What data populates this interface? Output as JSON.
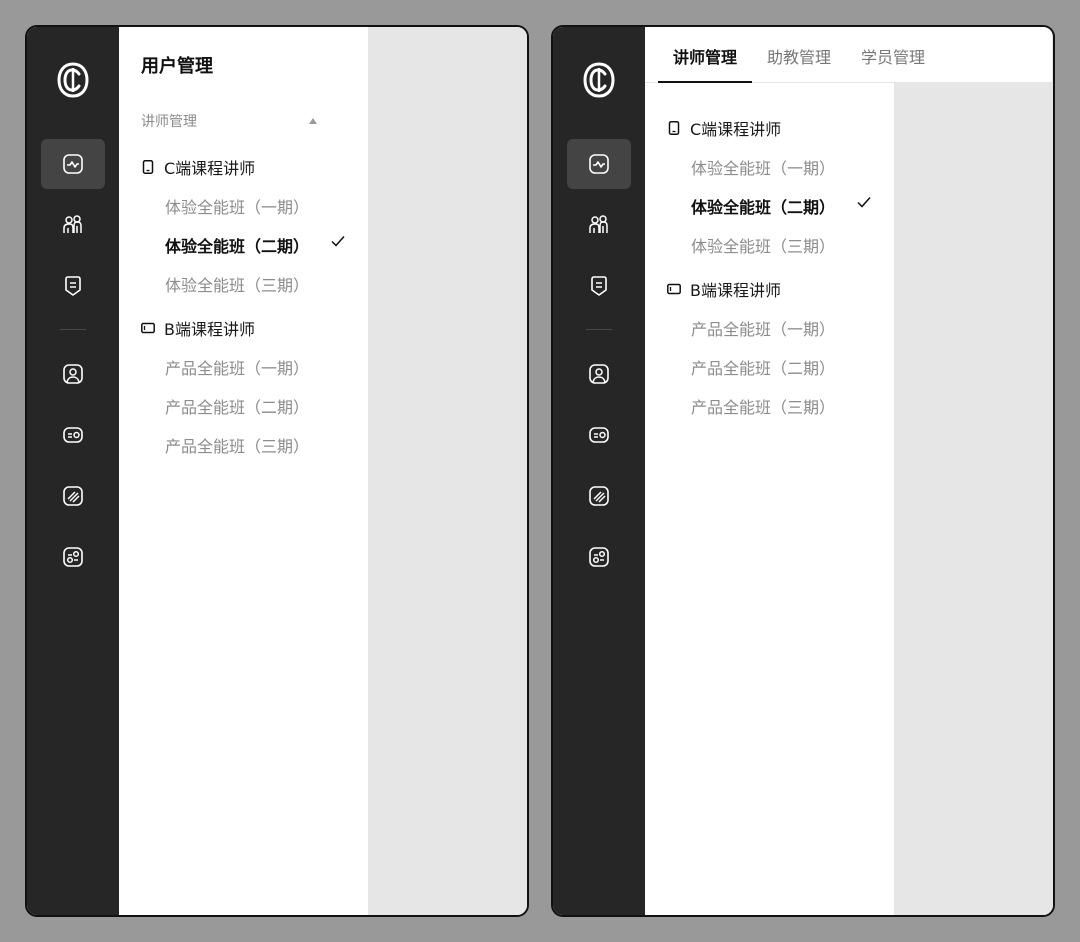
{
  "left": {
    "panel_title": "用户管理",
    "section": "讲师管理",
    "groups": [
      {
        "title": "C端课程讲师",
        "icon": "phone-icon",
        "items": [
          "体验全能班（一期）",
          "体验全能班（二期）",
          "体验全能班（三期）"
        ],
        "selected_index": 1
      },
      {
        "title": "B端课程讲师",
        "icon": "tablet-icon",
        "items": [
          "产品全能班（一期）",
          "产品全能班（二期）",
          "产品全能班（三期）"
        ]
      }
    ]
  },
  "right": {
    "tabs": [
      "讲师管理",
      "助教管理",
      "学员管理"
    ],
    "active_tab": 0,
    "groups": [
      {
        "title": "C端课程讲师",
        "icon": "phone-icon",
        "items": [
          "体验全能班（一期）",
          "体验全能班（二期）",
          "体验全能班（三期）"
        ],
        "selected_index": 1
      },
      {
        "title": "B端课程讲师",
        "icon": "tablet-icon",
        "items": [
          "产品全能班（一期）",
          "产品全能班（二期）",
          "产品全能班（三期）"
        ]
      }
    ]
  },
  "rail": {
    "icons": [
      "activity-icon",
      "users-icon",
      "badge-icon",
      "user-square-icon",
      "card-icon",
      "stripes-icon",
      "connect-icon"
    ],
    "active_index": 0
  },
  "colors": {
    "rail": "#262626",
    "active_nav": "#444444",
    "background": "#999999"
  }
}
